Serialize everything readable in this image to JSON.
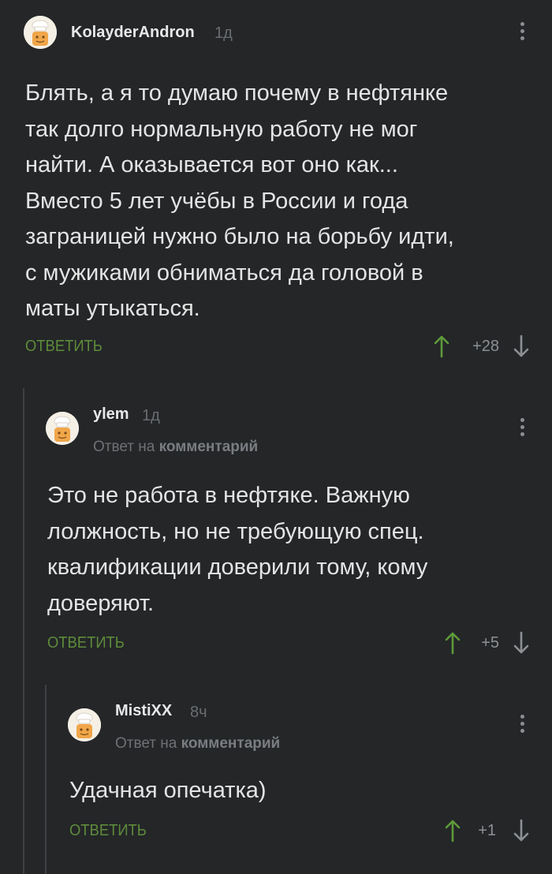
{
  "comments": [
    {
      "username": "KolayderAndron",
      "time": "1д",
      "reply_to": null,
      "text": "Блять, а я то думаю почему в нефтянке\nтак долго нормальную работу не мог\nнайти. А оказывается вот оно как...\nВместо 5 лет учёбы в России и года\nзаграницей нужно было на борьбу идти,\nс мужиками обниматься да головой в\nматы утыкаться.",
      "reply_label": "ОТВЕТИТЬ",
      "rating": "+28"
    },
    {
      "username": "ylem",
      "time": "1д",
      "reply_to": {
        "prefix": "Ответ на",
        "target": "комментарий"
      },
      "text": "Это не работа в нефтяке. Важную\nлолжность, но не требующую спец.\nквалификации доверили тому, кому\nдоверяют.",
      "reply_label": "ОТВЕТИТЬ",
      "rating": "+5"
    },
    {
      "username": "MistiXX",
      "time": "8ч",
      "reply_to": {
        "prefix": "Ответ на",
        "target": "комментарий"
      },
      "text": "Удачная опечатка)",
      "reply_label": "ОТВЕТИТЬ",
      "rating": "+1"
    }
  ],
  "icons": {
    "avatar": "default-chef-avatar-icon",
    "menu": "kebab-menu-icon",
    "upvote": "arrow-up-icon",
    "downvote": "arrow-down-icon"
  },
  "colors": {
    "background": "#242628",
    "accent_green": "#5e8c3a",
    "upvote_green": "#5e9a3a",
    "muted": "#6a6d70",
    "thread_line": "#3d4043"
  }
}
